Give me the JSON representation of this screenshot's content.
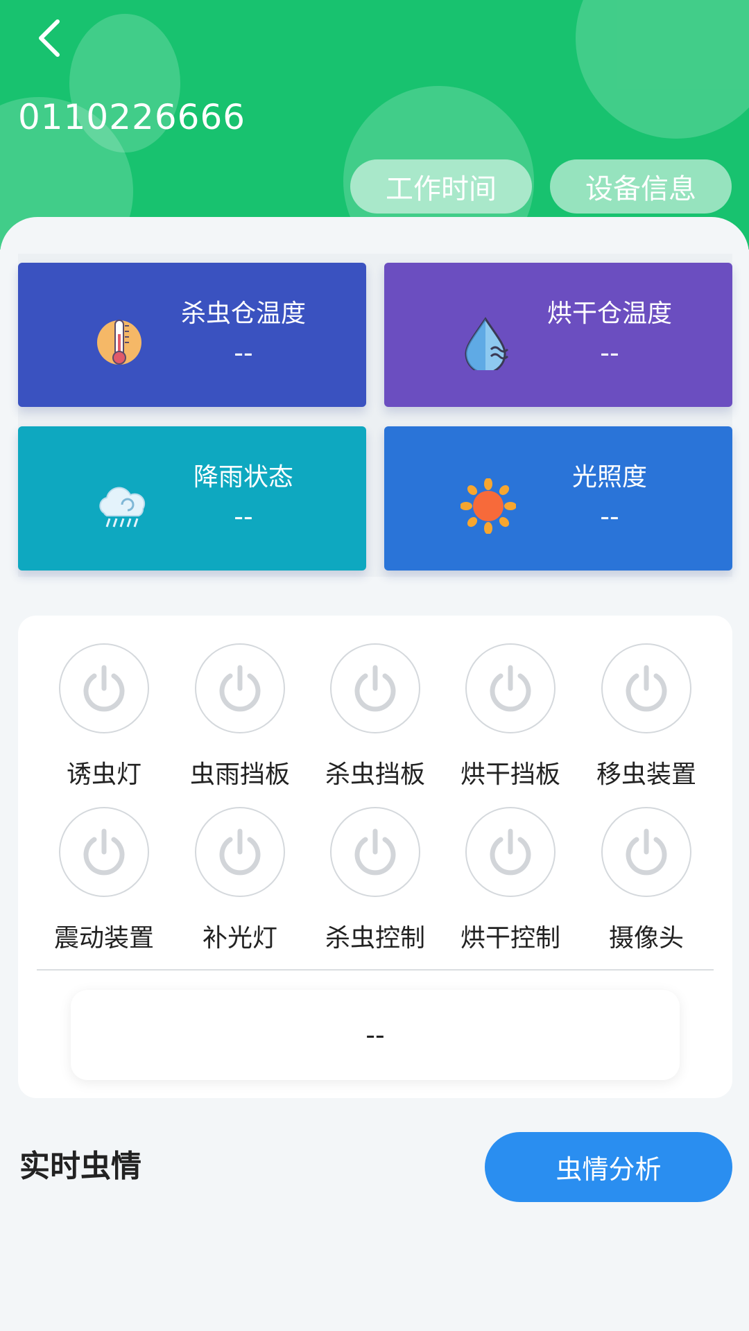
{
  "header": {
    "back_icon": "chevron-left-icon",
    "device_id": "0110226666",
    "work_time_label": "工作时间",
    "device_info_label": "设备信息",
    "accent": "#18c26f"
  },
  "sensors": [
    {
      "label": "杀虫仓温度",
      "value": "--",
      "icon": "thermometer-icon",
      "color": "#3a52c0"
    },
    {
      "label": "烘干仓温度",
      "value": "--",
      "icon": "humidity-drop-icon",
      "color": "#6b4ec0"
    },
    {
      "label": "降雨状态",
      "value": "--",
      "icon": "rain-cloud-icon",
      "color": "#0ea8c0"
    },
    {
      "label": "光照度",
      "value": "--",
      "icon": "sun-icon",
      "color": "#2a74d8"
    }
  ],
  "controls": [
    {
      "label": "诱虫灯",
      "icon": "power-icon"
    },
    {
      "label": "虫雨挡板",
      "icon": "power-icon"
    },
    {
      "label": "杀虫挡板",
      "icon": "power-icon"
    },
    {
      "label": "烘干挡板",
      "icon": "power-icon"
    },
    {
      "label": "移虫装置",
      "icon": "power-icon"
    },
    {
      "label": "震动装置",
      "icon": "power-icon"
    },
    {
      "label": "补光灯",
      "icon": "power-icon"
    },
    {
      "label": "杀虫控制",
      "icon": "power-icon"
    },
    {
      "label": "烘干控制",
      "icon": "power-icon"
    },
    {
      "label": "摄像头",
      "icon": "power-icon"
    }
  ],
  "status_text": "--",
  "insect": {
    "section_title": "实时虫情",
    "analysis_button": "虫情分析",
    "button_color": "#2a8ef0"
  }
}
